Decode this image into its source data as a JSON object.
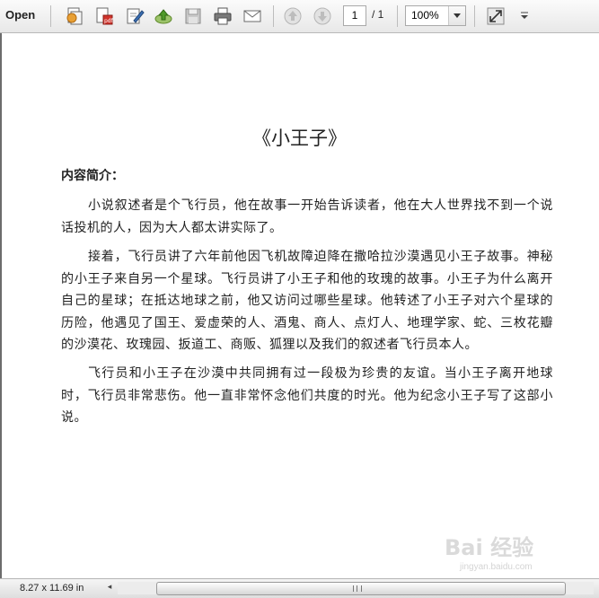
{
  "toolbar": {
    "open_label": "Open",
    "page_current": "1",
    "page_total": "/ 1",
    "zoom_value": "100%",
    "icons": [
      "create-pdf-icon",
      "export-icon",
      "edit-icon",
      "upload-icon",
      "save-icon",
      "print-icon",
      "email-icon",
      "page-up-icon",
      "page-down-icon",
      "fullscreen-icon",
      "menu-arrow-icon"
    ]
  },
  "document": {
    "title": "《小王子》",
    "heading": "内容简介：",
    "paragraphs": [
      "小说叙述者是个飞行员，他在故事一开始告诉读者，他在大人世界找不到一个说话投机的人，因为大人都太讲实际了。",
      "接着，飞行员讲了六年前他因飞机故障迫降在撒哈拉沙漠遇见小王子故事。神秘的小王子来自另一个星球。飞行员讲了小王子和他的玫瑰的故事。小王子为什么离开自己的星球；在抵达地球之前，他又访问过哪些星球。他转述了小王子对六个星球的历险，他遇见了国王、爱虚荣的人、酒鬼、商人、点灯人、地理学家、蛇、三枚花瓣的沙漠花、玫瑰园、扳道工、商贩、狐狸以及我们的叙述者飞行员本人。",
      "飞行员和小王子在沙漠中共同拥有过一段极为珍贵的友谊。当小王子离开地球时，飞行员非常悲伤。他一直非常怀念他们共度的时光。他为纪念小王子写了这部小说。"
    ]
  },
  "status_bar": {
    "page_size": "8.27 x 11.69 in"
  },
  "watermark": {
    "text": "Bai 经验",
    "sub": "jingyan.baidu.com"
  }
}
